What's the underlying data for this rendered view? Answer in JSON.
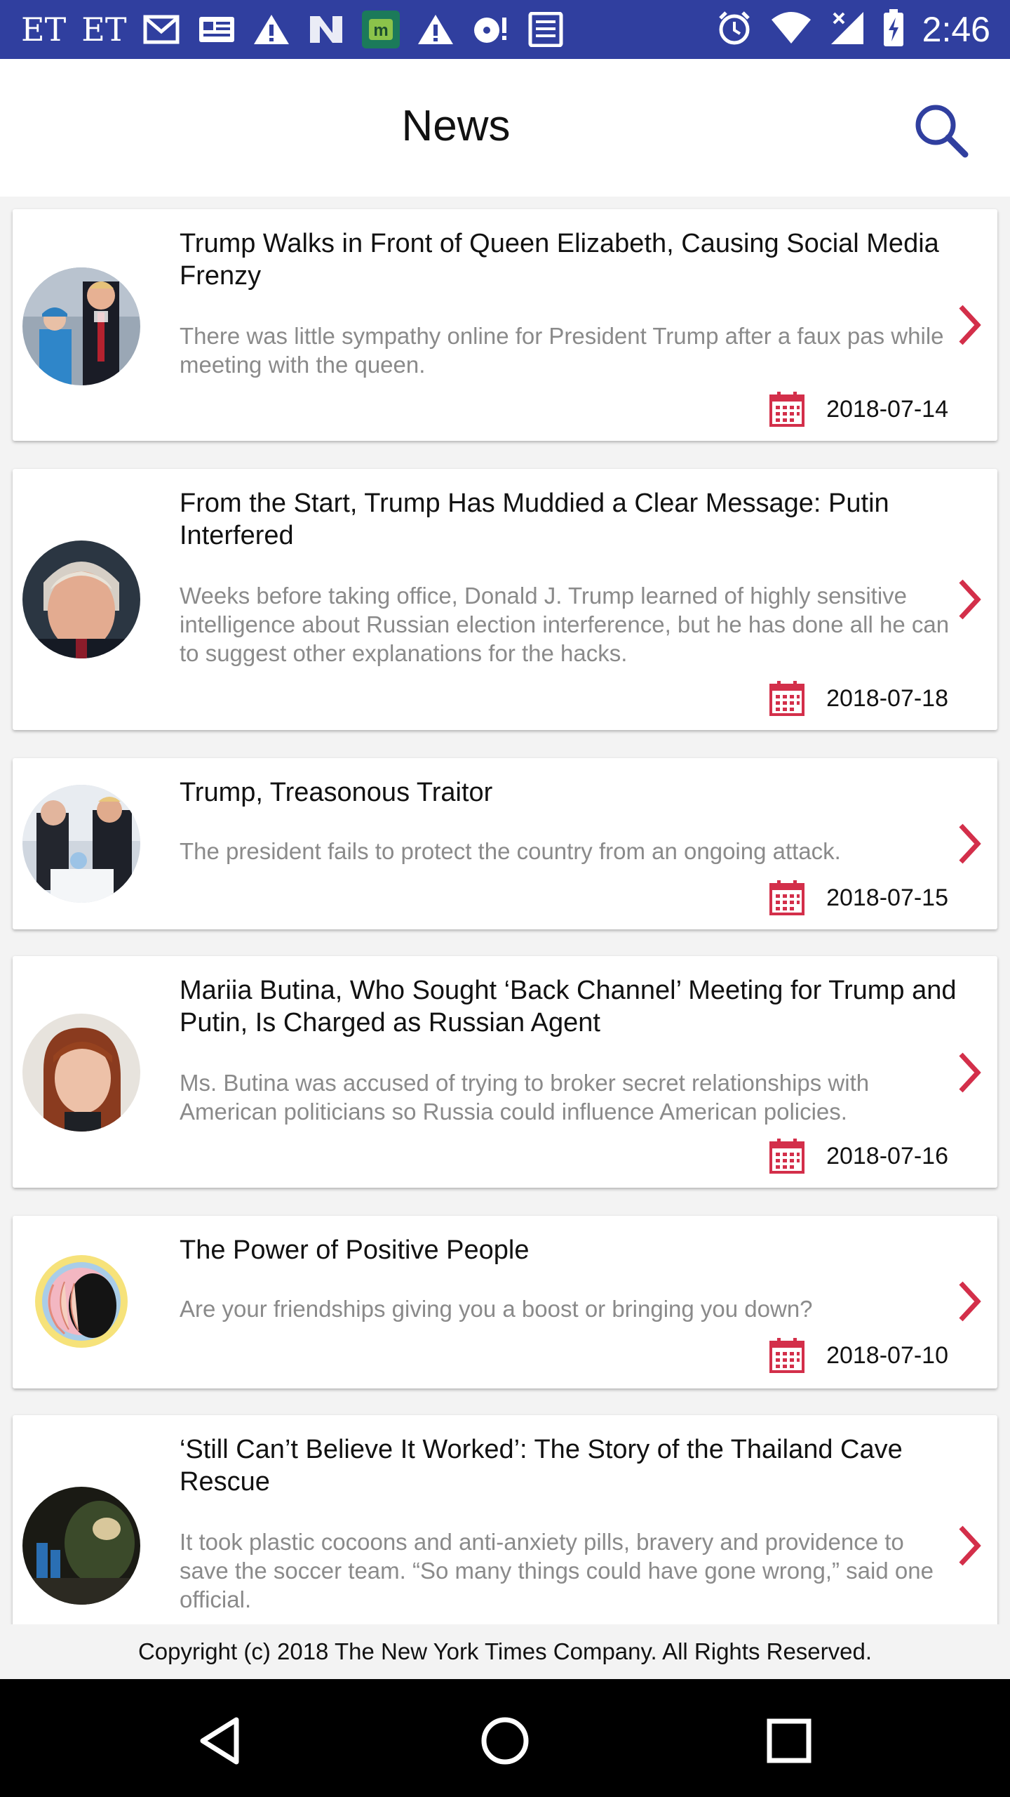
{
  "status_bar": {
    "left_text_1": "ET",
    "left_text_2": "ET",
    "icons": [
      "gmail-icon",
      "news-card-icon",
      "warning-icon",
      "n-app-icon",
      "m-app-icon",
      "warning-icon",
      "cd-alert-icon",
      "newspaper-icon"
    ],
    "right_icons": [
      "alarm-icon",
      "wifi-icon",
      "signal-icon",
      "battery-charging-icon"
    ],
    "time": "2:46"
  },
  "app_bar": {
    "title": "News",
    "search_icon": "search-icon",
    "accent_color": "#303f9f"
  },
  "articles": [
    {
      "title": "Trump Walks in Front of Queen Elizabeth, Causing Social Media Frenzy",
      "description": "There was little sympathy online for President Trump after a faux pas while meeting with the queen.",
      "date": "2018-07-14"
    },
    {
      "title": "From the Start, Trump Has Muddied a Clear Message: Putin Interfered",
      "description": "Weeks before taking office, Donald J. Trump learned of highly sensitive intelligence about Russian election interference, but he has done all he can to suggest other explanations for the hacks.",
      "date": "2018-07-18"
    },
    {
      "title": "Trump, Treasonous Traitor",
      "description": "The president fails to protect the country from an ongoing attack.",
      "date": "2018-07-15"
    },
    {
      "title": "Mariia Butina, Who Sought ‘Back Channel’ Meeting for Trump and Putin, Is Charged as Russian Agent",
      "description": "Ms. Butina was accused of trying to broker secret relationships with American politicians so Russia could influence American policies.",
      "date": "2018-07-16"
    },
    {
      "title": "The Power of Positive People",
      "description": "Are your friendships giving you a boost or bringing you down?",
      "date": "2018-07-10"
    },
    {
      "title": "‘Still Can’t Believe It Worked’: The Story of the Thailand Cave Rescue",
      "description": "It took plastic cocoons and anti-anxiety pills, bravery and providence to save the soccer team. “So many things could have gone wrong,” said one official.",
      "date": ""
    }
  ],
  "date_icon": "calendar-icon",
  "chevron_icon": "chevron-right-icon",
  "accent_red": "#d32f4a",
  "footer": {
    "copyright": "Copyright (c) 2018 The New York Times Company.  All Rights Reserved."
  },
  "nav_bar": {
    "buttons": [
      "back-icon",
      "home-icon",
      "recents-icon"
    ]
  }
}
